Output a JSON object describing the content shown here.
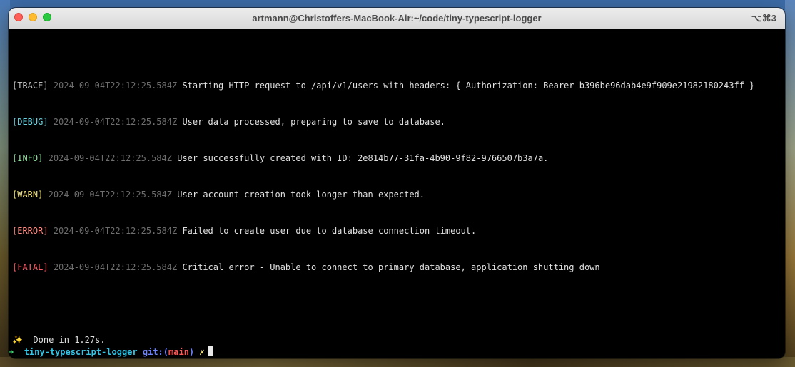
{
  "window": {
    "title": "artmann@Christoffers-MacBook-Air:~/code/tiny-typescript-logger",
    "shortcut": "⌥⌘3"
  },
  "logs": [
    {
      "level": "[TRACE]",
      "timestamp": "2024-09-04T22:12:25.584Z",
      "message": "Starting HTTP request to /api/v1/users with headers: { Authorization: Bearer b396be96dab4e9f909e21982180243ff }"
    },
    {
      "level": "[DEBUG]",
      "timestamp": "2024-09-04T22:12:25.584Z",
      "message": "User data processed, preparing to save to database."
    },
    {
      "level": "[INFO]",
      "timestamp": "2024-09-04T22:12:25.584Z",
      "message": "User successfully created with ID: 2e814b77-31fa-4b90-9f82-9766507b3a7a."
    },
    {
      "level": "[WARN]",
      "timestamp": "2024-09-04T22:12:25.584Z",
      "message": "User account creation took longer than expected."
    },
    {
      "level": "[ERROR]",
      "timestamp": "2024-09-04T22:12:25.584Z",
      "message": "Failed to create user due to database connection timeout."
    },
    {
      "level": "[FATAL]",
      "timestamp": "2024-09-04T22:12:25.584Z",
      "message": "Critical error - Unable to connect to primary database, application shutting down"
    }
  ],
  "done": {
    "icon": "sparkles-icon",
    "text": "Done in 1.27s."
  },
  "prompt": {
    "arrow": "➜",
    "directory": "tiny-typescript-logger",
    "git_label": "git:",
    "paren_open": "(",
    "branch": "main",
    "paren_close": ")",
    "dirty": "✗"
  },
  "colors": {
    "trace": "#bdbdbd",
    "debug": "#6fd3df",
    "info": "#8fdfa0",
    "warn": "#f2e37a",
    "error": "#ff8f86",
    "fatal": "#ff5f6a",
    "timestamp": "#6e6e6e",
    "terminal_bg": "#000000"
  }
}
